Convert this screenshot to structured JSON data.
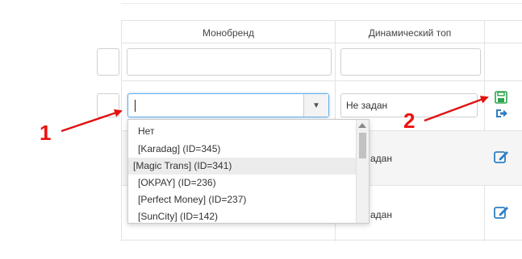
{
  "table": {
    "columns": [
      {
        "label": "Монобренд"
      },
      {
        "label": "Динамический топ"
      }
    ],
    "edit_row": {
      "monobrand_input_value": "",
      "dynamic_top_value": "Не задан"
    },
    "rows": [
      {
        "dynamic_top_text": "адан"
      },
      {
        "dynamic_top_text": "адан"
      }
    ]
  },
  "dropdown": {
    "options": [
      "Нет",
      "[Karadag] (ID=345)",
      "[Magic Trans] (ID=341)",
      "[OKPAY] (ID=236)",
      "[Perfect Money] (ID=237)",
      "[SunCity] (ID=142)"
    ],
    "highlighted_index": 2
  },
  "annotations": {
    "label_1": "1",
    "label_2": "2",
    "color": "#e11111"
  },
  "icons": {
    "save": "save-icon",
    "cancel": "exit-icon",
    "edit": "edit-icon"
  },
  "colors": {
    "save_icon": "#2ea44f",
    "action_icon": "#2f7fc1",
    "focus_border": "#66afe9"
  }
}
